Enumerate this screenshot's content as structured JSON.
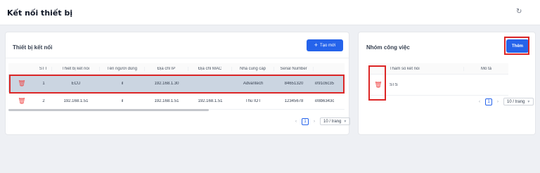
{
  "page": {
    "title": "Kết nối thiết bị",
    "refresh_icon": "↻"
  },
  "devices_panel": {
    "title": "Thiết bị kết nối",
    "create_button": {
      "icon": "+",
      "label": "Tạo mới"
    },
    "columns": [
      "STT",
      "Thiết bị kết nối",
      "Tên người dùng",
      "Địa chỉ IP",
      "Địa chỉ MAC",
      "Nhà cung cấp",
      "Serial Number",
      ""
    ],
    "rows": [
      {
        "stt": "1",
        "device": "ECU",
        "user": "il",
        "ip": "192.168.1.30",
        "mac": "",
        "vendor": "Advantech",
        "serial": "84651320",
        "extra": "il/91c6c35"
      },
      {
        "stt": "2",
        "device": "192.168.1.51",
        "user": "il",
        "ip": "192.168.1.51",
        "mac": "192.168.1.51",
        "vendor": "Thu IOT",
        "serial": "12345678",
        "extra": "il/8b6343c"
      }
    ],
    "pagination": {
      "prev": "‹",
      "page": "1",
      "next": "›",
      "page_size": "10 / trang"
    }
  },
  "groups_panel": {
    "title": "Nhóm công việc",
    "add_button": "Thêm",
    "columns": [
      "Tham số kết nối",
      "Mô tả"
    ],
    "rows": [
      {
        "param": "STS",
        "desc": ""
      }
    ],
    "pagination": {
      "prev": "‹",
      "page": "1",
      "next": "›",
      "page_size": "10 / trang"
    }
  },
  "icons": {
    "trash": "🗑"
  },
  "colors": {
    "primary": "#2563eb",
    "highlight": "#dc2626",
    "selected_row": "#cbd5e1",
    "delete": "#ef4444"
  }
}
